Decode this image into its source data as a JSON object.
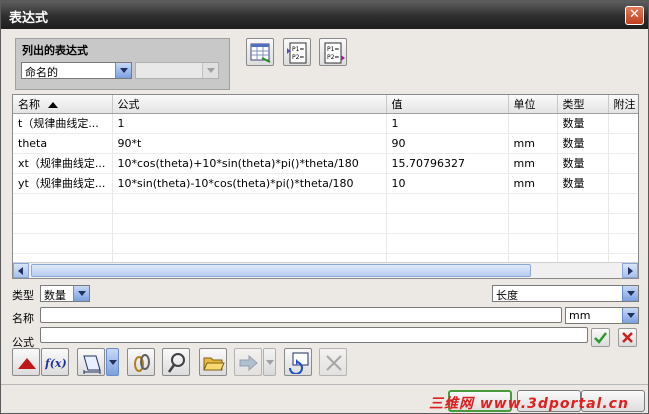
{
  "window": {
    "title": "表达式"
  },
  "filter_group": {
    "label": "列出的表达式",
    "list_select": "命名的",
    "secondary_select": ""
  },
  "table": {
    "columns": [
      "名称",
      "公式",
      "值",
      "单位",
      "类型",
      "附注"
    ],
    "rows": [
      {
        "name": "t（规律曲线定...",
        "formula": "1",
        "value": "1",
        "unit": "",
        "type": "数量",
        "note": ""
      },
      {
        "name": "theta",
        "formula": "90*t",
        "value": "90",
        "unit": "mm",
        "type": "数量",
        "note": ""
      },
      {
        "name": "xt（规律曲线定...",
        "formula": "10*cos(theta)+10*sin(theta)*pi()*theta/180",
        "value": "15.70796327",
        "unit": "mm",
        "type": "数量",
        "note": ""
      },
      {
        "name": "yt（规律曲线定...",
        "formula": "10*sin(theta)-10*cos(theta)*pi()*theta/180",
        "value": "10",
        "unit": "mm",
        "type": "数量",
        "note": ""
      }
    ],
    "empty_row_count": 4
  },
  "editor": {
    "type_label": "类型",
    "type_value": "数量",
    "dimension_value": "长度",
    "name_label": "名称",
    "name_value": "",
    "unit_value": "mm",
    "formula_label": "公式",
    "formula_value": ""
  },
  "footer": {
    "watermark": "三维网 www.3dportal.cn"
  },
  "icons": {
    "close": "close-icon",
    "list_all": "spreadsheet-icon",
    "list_p1p2": "p1-p2-icon",
    "list_p1p2_arrow": "p1-p2-arrow-icon",
    "accept": "check-icon",
    "reject": "x-icon",
    "collapse": "triangle-up-icon",
    "function": "fx-icon",
    "measure": "measure-icon",
    "reference": "chain-link-icon",
    "link_expr": "linked-expression-icon",
    "open_file": "folder-open-icon",
    "import": "import-arrow-icon",
    "delay_update": "refresh-icon",
    "delete": "delete-x-icon"
  },
  "colors": {
    "title_bar": "#2e2e2e",
    "accent": "#7aa0e0",
    "watermark": "#e02020"
  }
}
